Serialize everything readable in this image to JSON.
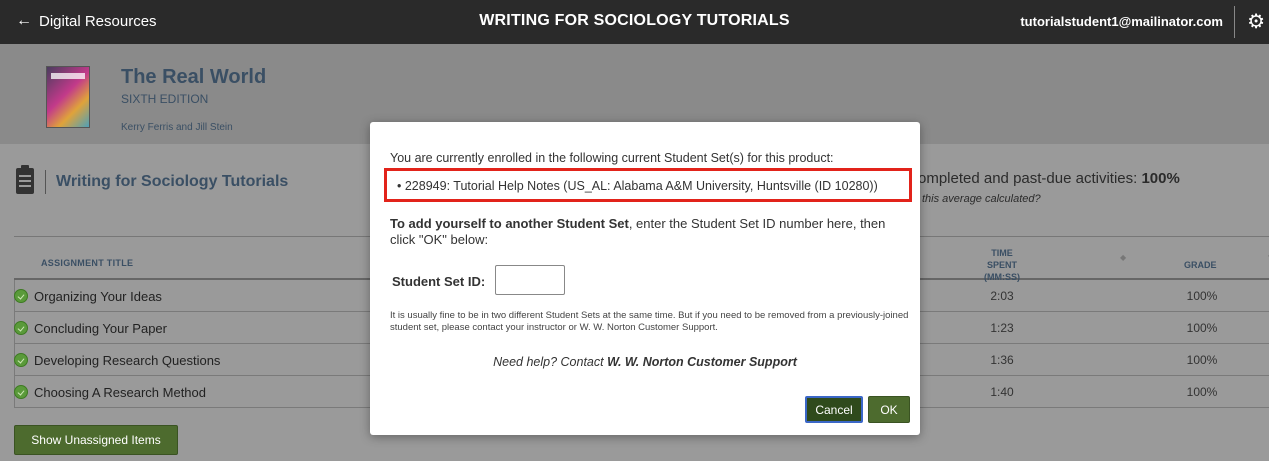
{
  "topbar": {
    "back_label": "Digital Resources",
    "title": "WRITING FOR SOCIOLOGY TUTORIALS",
    "email": "tutorialstudent1@mailinator.com",
    "back_icon": "arrow-left-icon",
    "settings_icon": "gears-icon"
  },
  "product": {
    "title": "The Real World",
    "edition": "SIXTH EDITION",
    "authors": "Kerry Ferris and Jill Stein"
  },
  "section": {
    "title": "Writing for Sociology Tutorials",
    "avg_text": "ompleted and past-due activities: ",
    "avg_value": "100%",
    "avg_link": "this average calculated?"
  },
  "table": {
    "headers": {
      "title": "ASSIGNMENT TITLE",
      "time_spent": "TIME SPENT",
      "time_format": "(MM:SS)",
      "grade": "GRADE"
    },
    "rows": [
      {
        "name": "Organizing Your Ideas",
        "time": "2:03",
        "grade": "100%"
      },
      {
        "name": "Concluding Your Paper",
        "time": "1:23",
        "grade": "100%"
      },
      {
        "name": "Developing Research Questions",
        "time": "1:36",
        "grade": "100%"
      },
      {
        "name": "Choosing A Research Method",
        "time": "1:40",
        "grade": "100%"
      }
    ]
  },
  "show_unassigned_label": "Show Unassigned Items",
  "modal": {
    "intro": "You are currently enrolled in the following current Student Set(s) for this product:",
    "enrolled_set": "228949: Tutorial Help Notes (US_AL: Alabama A&M University, Huntsville (ID 10280))",
    "add_bold": "To add yourself to another Student Set",
    "add_rest": ", enter the Student Set ID number here, then click \"OK\" below:",
    "id_label": "Student Set ID:",
    "id_value": "",
    "note": "It is usually fine to be in two different Student Sets at the same time. But if you need to be removed from a previously-joined student set, please contact your instructor or W. W. Norton Customer Support.",
    "help_prefix": "Need help? Contact ",
    "help_link": "W. W. Norton Customer Support",
    "cancel_label": "Cancel",
    "ok_label": "OK"
  },
  "colors": {
    "highlight": "#e2231a",
    "button_green": "#4d6b2e",
    "topbar": "#2a2a2a"
  }
}
